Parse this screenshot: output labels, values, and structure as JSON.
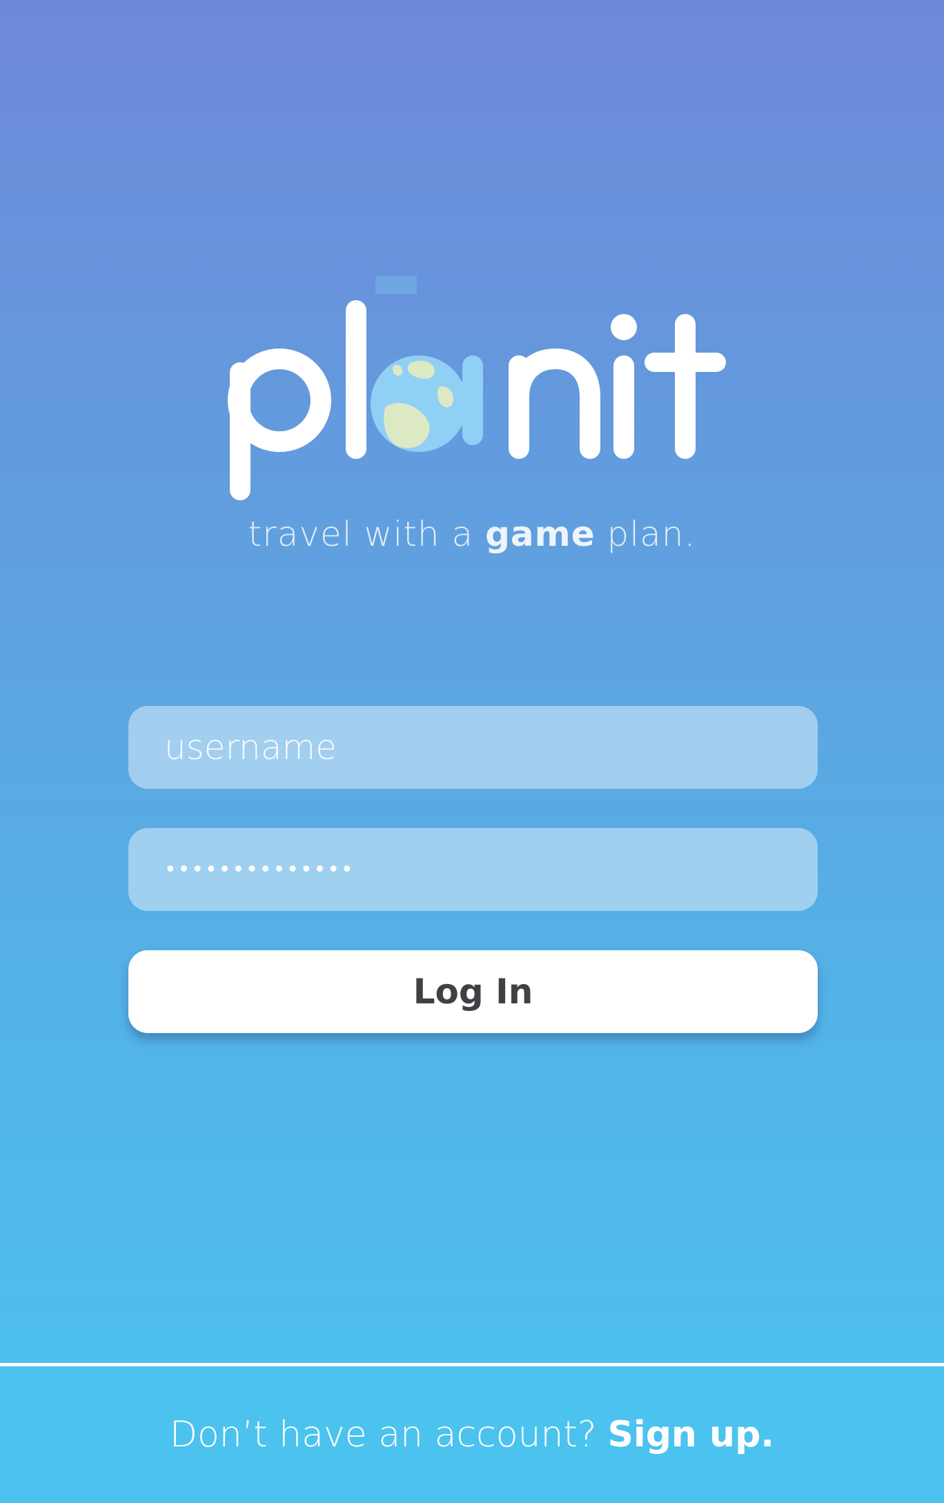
{
  "app": {
    "logo_text": "planit",
    "tagline_pre": "travel with a",
    "tagline_bold": "game",
    "tagline_post": "plan."
  },
  "form": {
    "username_placeholder": "username",
    "password_masked": "••••••••••••••",
    "login_label": "Log In"
  },
  "footer": {
    "prompt": "Don’t have an account?",
    "signup_label": "Sign up."
  },
  "colors": {
    "gradient_top": "#6e88d8",
    "gradient_bottom": "#4cc3ee",
    "footer_bg": "#4bc3ee",
    "button_bg": "#ffffff",
    "button_text": "#3f4145",
    "globe_ocean": "#8fd0f4",
    "globe_land": "#dde9c4"
  },
  "icons": {
    "logo_globe": "globe-icon"
  }
}
